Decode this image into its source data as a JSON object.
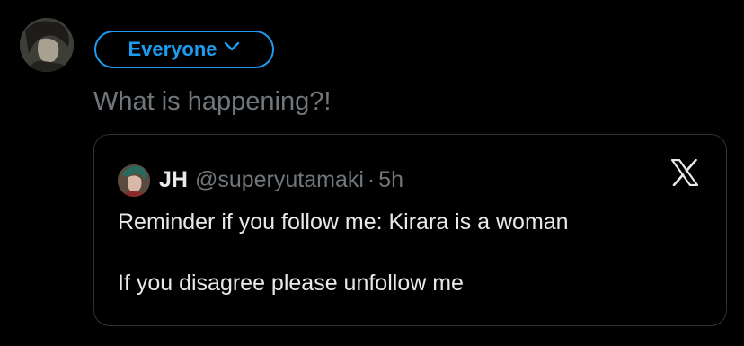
{
  "composer": {
    "avatar_icon": "user-avatar",
    "audience_label": "Everyone",
    "audience_icon": "chevron-down-icon",
    "text": "",
    "placeholder": "What is happening?!",
    "accent_color": "#1d9bf0"
  },
  "quoted_post": {
    "avatar_icon": "user-avatar",
    "display_name": "JH",
    "handle": "@superyutamaki",
    "separator": "·",
    "time": "5h",
    "remove_icon": "x-logo-icon",
    "body_lines": [
      "Reminder if you follow me: Kirara is a woman",
      "If you disagree please unfollow me"
    ]
  }
}
